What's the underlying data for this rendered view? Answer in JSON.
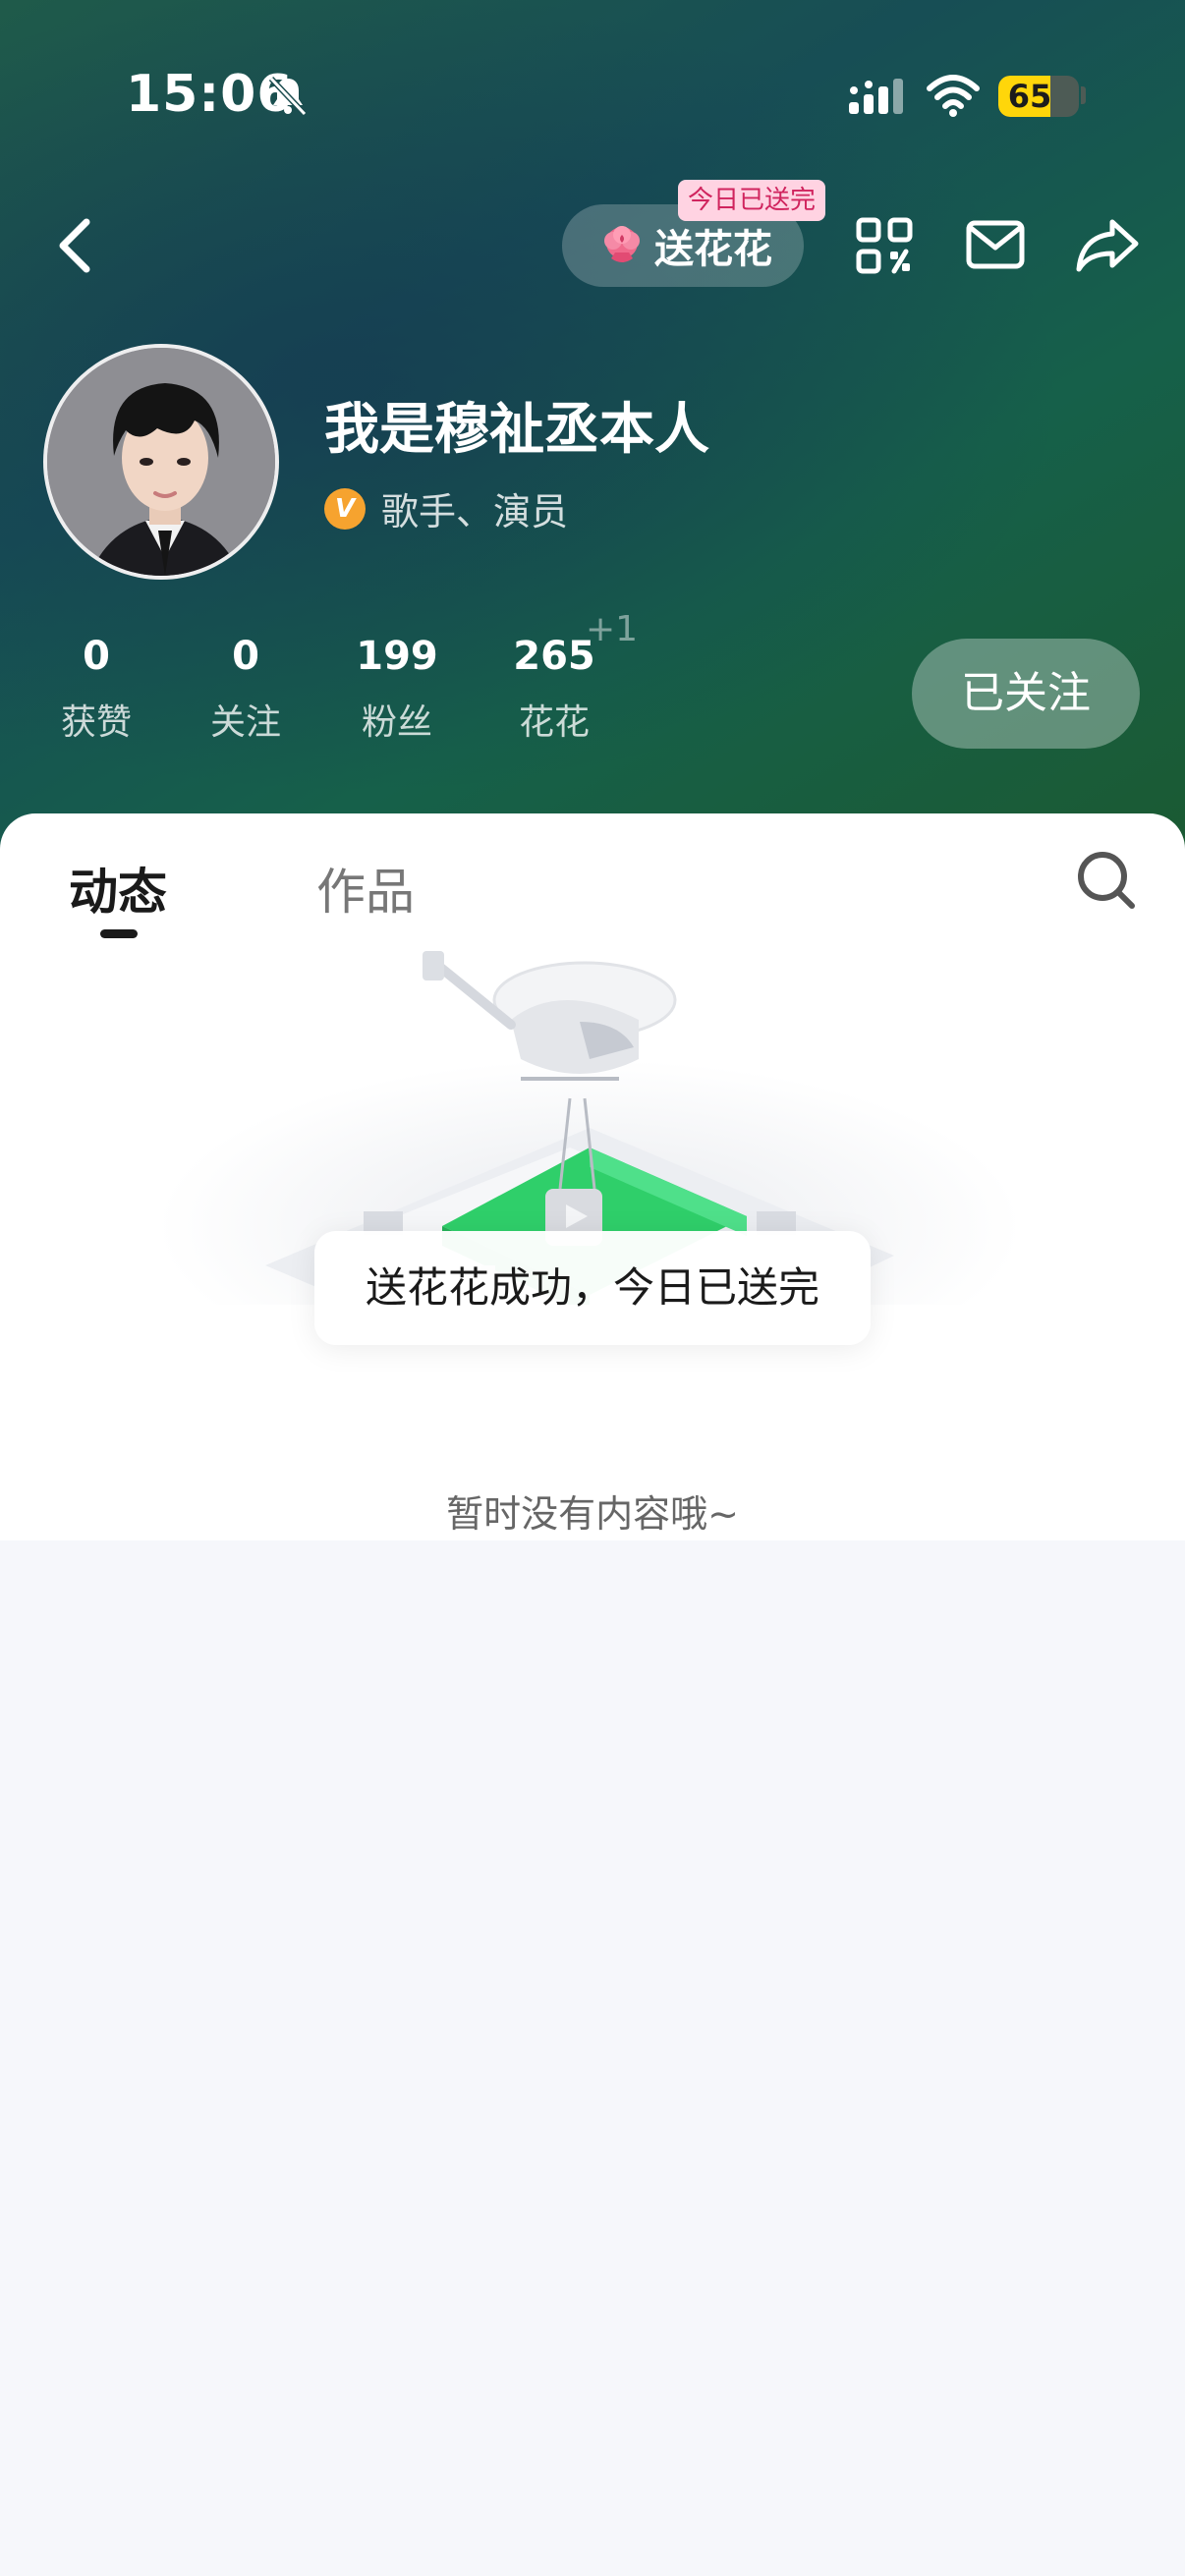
{
  "status_bar": {
    "time": "15:06",
    "battery_level": "65",
    "battery_fraction": 0.65,
    "icons": [
      "bell-slash-icon",
      "cellular-signal-icon",
      "wifi-icon",
      "battery-icon"
    ]
  },
  "nav": {
    "back_icon": "chevron-left-icon",
    "send_flower_label": "送花花",
    "send_flower_badge": "今日已送完",
    "flower_icon": "flower-icon",
    "actions": [
      "qr-code-icon",
      "mail-icon",
      "share-icon"
    ]
  },
  "profile": {
    "name": "我是穆祉丞本人",
    "verification_text": "歌手、演员",
    "verify_badge": "V"
  },
  "stats": [
    {
      "value": "0",
      "label": "获赞"
    },
    {
      "value": "0",
      "label": "关注"
    },
    {
      "value": "199",
      "label": "粉丝"
    },
    {
      "value": "265",
      "label": "花花"
    }
  ],
  "stats_extra": {
    "flower_increment": "+1"
  },
  "follow_button": {
    "label": "已关注"
  },
  "tabs": [
    {
      "label": "动态",
      "active": true
    },
    {
      "label": "作品",
      "active": false
    }
  ],
  "empty_state": {
    "text": "暂时没有内容哦~"
  },
  "toast": {
    "text": "送花花成功，今日已送完"
  },
  "colors": {
    "header_start": "#1f5a4a",
    "header_end": "#1b5a32",
    "battery": "#ffd60a",
    "badge_bg": "#ffd3e2",
    "badge_text": "#d0245e",
    "verify": "#f6a32f",
    "illustration_green": "#2fcf6a"
  }
}
